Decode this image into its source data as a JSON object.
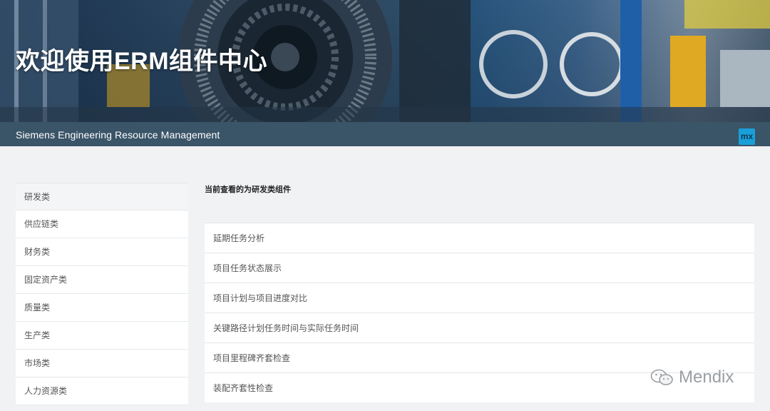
{
  "header": {
    "title": "欢迎使用ERM组件中心",
    "subtitle": "Siemens Engineering Resource Management",
    "logo_text": "mx"
  },
  "sidebar": {
    "items": [
      {
        "label": "研发类"
      },
      {
        "label": "供应链类"
      },
      {
        "label": "财务类"
      },
      {
        "label": "固定资产类"
      },
      {
        "label": "质量类"
      },
      {
        "label": "生产类"
      },
      {
        "label": "市场类"
      },
      {
        "label": "人力资源类"
      }
    ]
  },
  "main": {
    "heading": "当前查看的为研发类组件",
    "components": [
      {
        "label": "延期任务分析"
      },
      {
        "label": "项目任务状态展示"
      },
      {
        "label": "项目计划与项目进度对比"
      },
      {
        "label": "关键路径计划任务时间与实际任务时间"
      },
      {
        "label": "项目里程碑齐套检查"
      },
      {
        "label": "装配齐套性检查"
      }
    ]
  },
  "watermark": {
    "text": "Mendix",
    "icon": "wechat-icon"
  }
}
